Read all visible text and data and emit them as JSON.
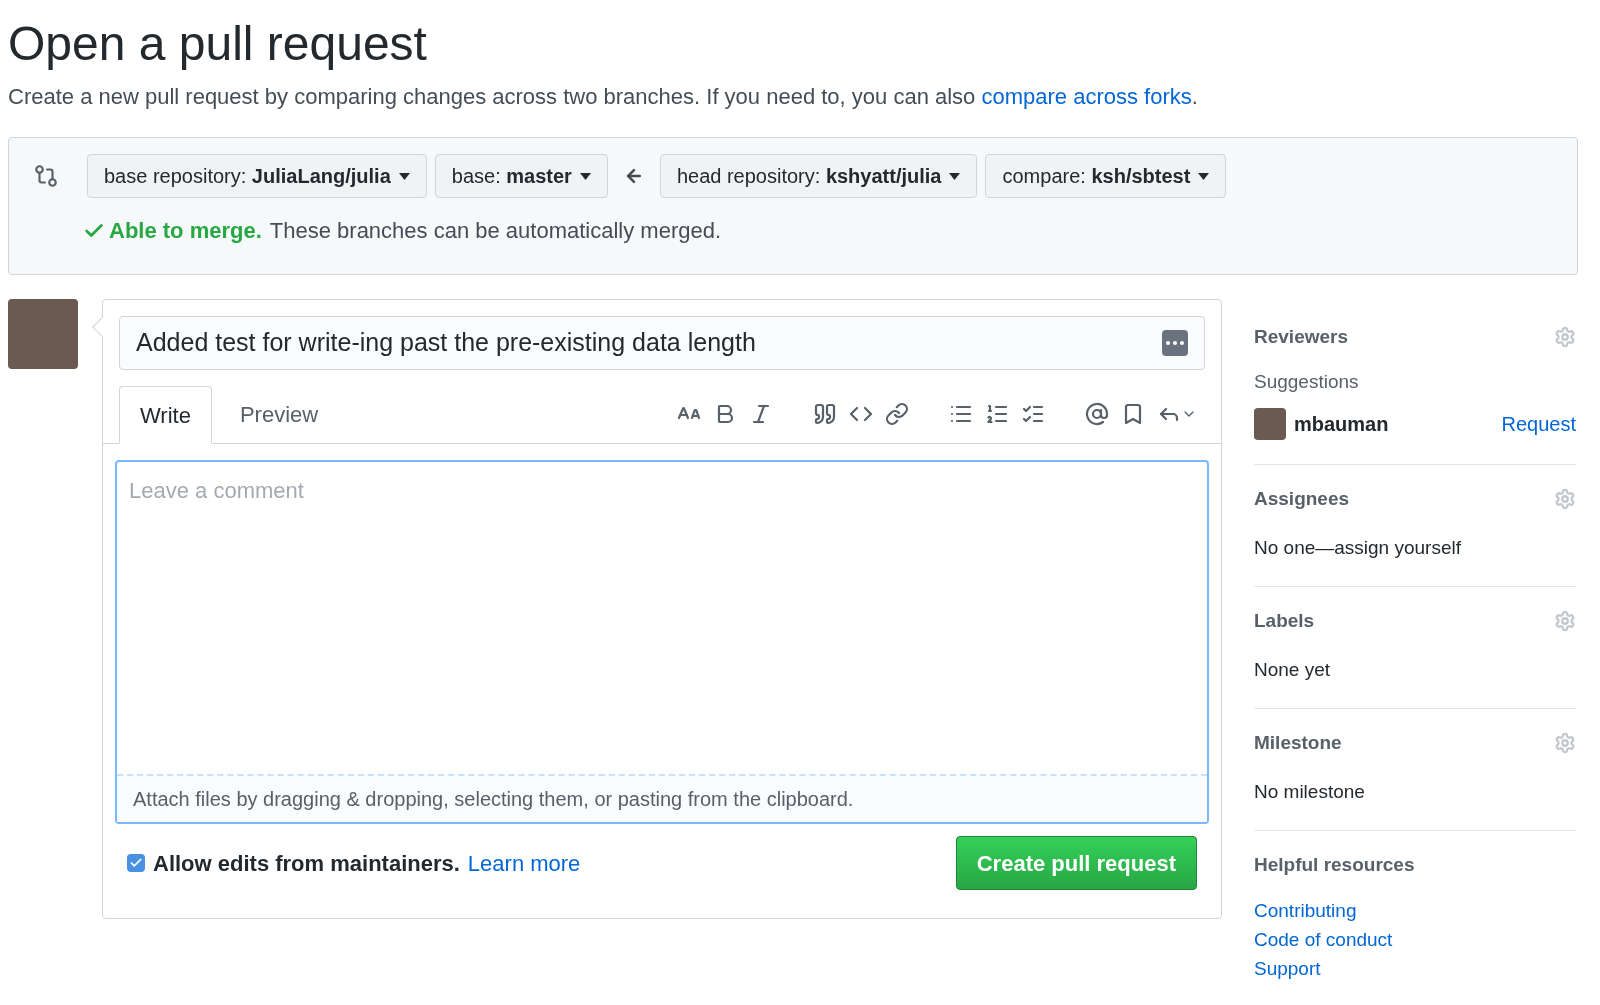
{
  "page_title": "Open a pull request",
  "subtitle": {
    "text": "Create a new pull request by comparing changes across two branches. If you need to, you can also ",
    "link": "compare across forks",
    "end": "."
  },
  "branches": [
    {
      "label": "base repository:",
      "value": "JuliaLang/julia"
    },
    {
      "label": "base:",
      "value": "master"
    },
    {
      "label": "head repository:",
      "value": "kshyatt/julia"
    },
    {
      "label": "compare:",
      "value": "ksh/sbtest"
    }
  ],
  "merge_status": {
    "status": "Able to merge.",
    "message": "These branches can be automatically merged."
  },
  "form": {
    "title_value": "Added test for write-ing past the pre-existing data length",
    "tabs": [
      {
        "label": "Write",
        "selected": true
      },
      {
        "label": "Preview",
        "selected": false
      }
    ],
    "comment_placeholder": "Leave a comment",
    "attach_hint": "Attach files by dragging & dropping, selecting them, or pasting from the clipboard.",
    "allow_edits": {
      "label": "Allow edits from maintainers.",
      "link": "Learn more",
      "checked": true
    },
    "submit": "Create pull request"
  },
  "sidebar": {
    "sections": [
      {
        "heading": "Reviewers",
        "kind": "reviewers",
        "subheading": "Suggestions",
        "suggestions": [
          {
            "user": "mbauman",
            "action": "Request"
          }
        ]
      },
      {
        "heading": "Assignees",
        "kind": "plain",
        "text": "No one—assign yourself"
      },
      {
        "heading": "Labels",
        "kind": "plain",
        "text": "None yet"
      },
      {
        "heading": "Milestone",
        "kind": "plain",
        "text": "No milestone"
      },
      {
        "heading": "Helpful resources",
        "kind": "links",
        "links": [
          "Contributing",
          "Code of conduct",
          "Support"
        ]
      }
    ]
  }
}
